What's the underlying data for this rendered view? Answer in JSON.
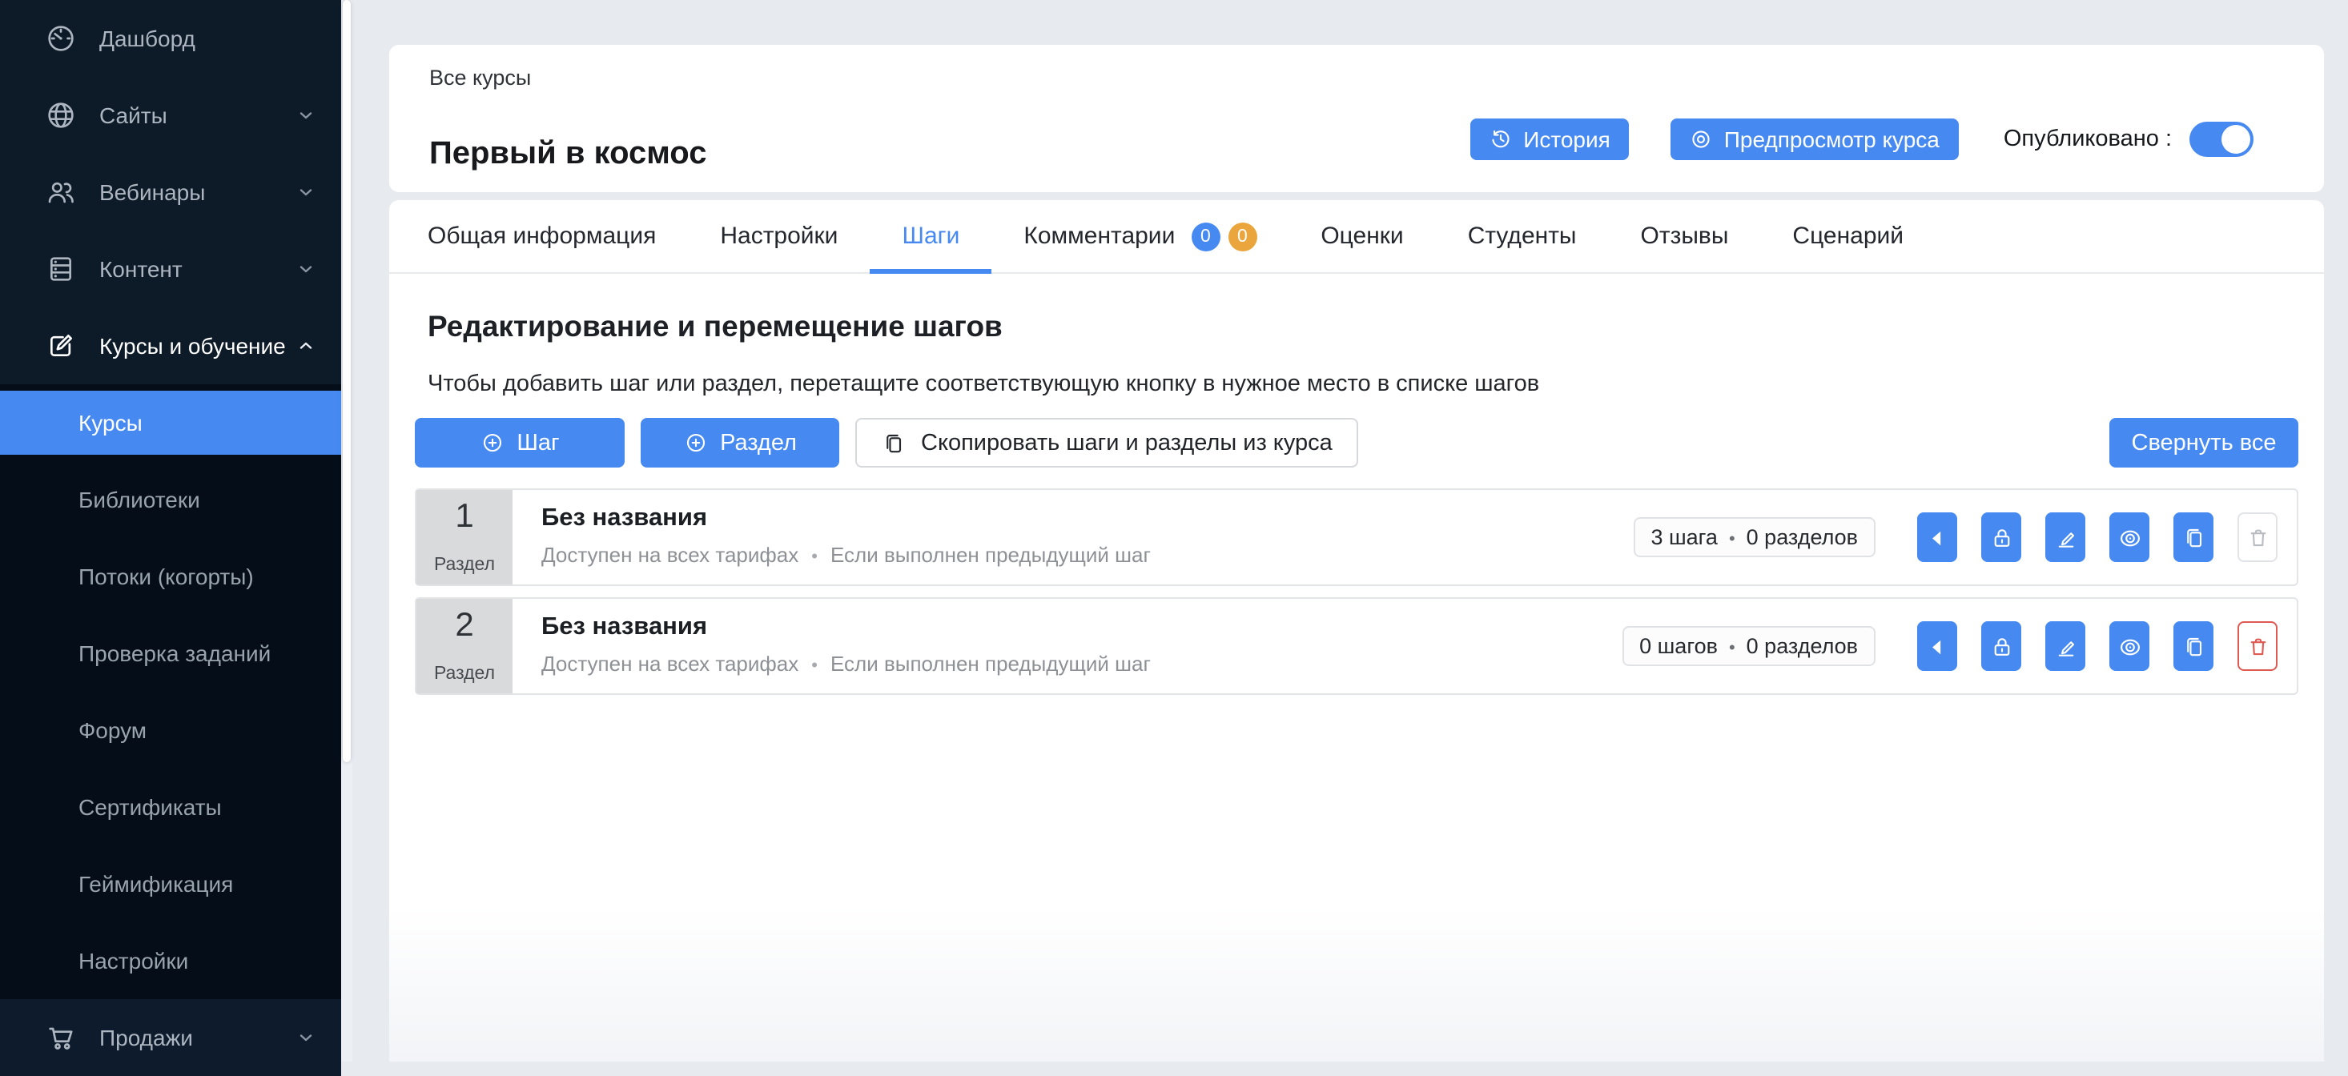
{
  "colors": {
    "accent": "#4589F1",
    "badge_blue": "#4589F1",
    "badge_orange": "#EBA53D",
    "danger": "#DF5A52",
    "sidebar_bg": "#0D1A28",
    "submenu_bg": "#050E18",
    "page_bg": "#E7EBF0"
  },
  "icons": {
    "gauge-icon": "speedometer",
    "globe-icon": "globe",
    "people-icon": "two-people",
    "content-icon": "stacked-list",
    "edit-icon": "pencil-square",
    "cart-icon": "shopping-cart",
    "history-icon": "clock-arrow",
    "preview-icon": "concentric-circles",
    "plus-circle-icon": "circled-plus",
    "copy-icon": "two-documents",
    "collapse-icon": "left-triangle",
    "lock-icon": "padlock",
    "pencil-icon": "pencil-underline",
    "view-icon": "eye-target",
    "duplicate-icon": "two-documents",
    "trash-icon": "trash-can",
    "chevron-down-icon": "chevron-down",
    "chevron-up-icon": "chevron-up"
  },
  "sidebar": {
    "items": [
      {
        "label": "Дашборд",
        "icon": "gauge-icon"
      },
      {
        "label": "Сайты",
        "icon": "globe-icon",
        "chevron": "down"
      },
      {
        "label": "Вебинары",
        "icon": "people-icon",
        "chevron": "down"
      },
      {
        "label": "Контент",
        "icon": "content-icon",
        "chevron": "down"
      },
      {
        "label": "Курсы и обучение",
        "icon": "edit-icon",
        "chevron": "up",
        "expanded": true
      }
    ],
    "submenu": {
      "items": [
        {
          "label": "Курсы",
          "selected": true
        },
        {
          "label": "Библиотеки"
        },
        {
          "label": "Потоки (когорты)"
        },
        {
          "label": "Проверка заданий"
        },
        {
          "label": "Форум"
        },
        {
          "label": "Сертификаты"
        },
        {
          "label": "Геймификация"
        },
        {
          "label": "Настройки"
        }
      ]
    },
    "bottom_item": {
      "label": "Продажи",
      "icon": "cart-icon",
      "chevron": "down"
    }
  },
  "header": {
    "breadcrumb": "Все курсы",
    "title": "Первый в космос",
    "history_button": "История",
    "preview_button": "Предпросмотр курса",
    "published": {
      "label": "Опубликовано :",
      "state": "on"
    }
  },
  "tabs": [
    {
      "label": "Общая информация"
    },
    {
      "label": "Настройки"
    },
    {
      "label": "Шаги",
      "active": true
    },
    {
      "label": "Комментарии",
      "badges": [
        {
          "value": "0",
          "color": "#4589F1"
        },
        {
          "value": "0",
          "color": "#EBA53D"
        }
      ]
    },
    {
      "label": "Оценки"
    },
    {
      "label": "Студенты"
    },
    {
      "label": "Отзывы"
    },
    {
      "label": "Сценарий"
    }
  ],
  "steps_panel": {
    "heading": "Редактирование и перемещение шагов",
    "hint": "Чтобы добавить шаг или раздел, перетащите соответствующую кнопку в нужное место в списке шагов",
    "step_button": "Шаг",
    "section_button": "Раздел",
    "copy_button": "Скопировать шаги и разделы из курса",
    "collapse_all_button": "Свернуть все",
    "rows": [
      {
        "number": "1",
        "type_label": "Раздел",
        "title": "Без названия",
        "availability": "Доступен на всех тарифах",
        "condition": "Если выполнен предыдущий шаг",
        "steps_count": "3 шага",
        "sections_count": "0 разделов",
        "delete_enabled": false
      },
      {
        "number": "2",
        "type_label": "Раздел",
        "title": "Без названия",
        "availability": "Доступен на всех тарифах",
        "condition": "Если выполнен предыдущий шаг",
        "steps_count": "0 шагов",
        "sections_count": "0 разделов",
        "delete_enabled": true
      }
    ]
  }
}
